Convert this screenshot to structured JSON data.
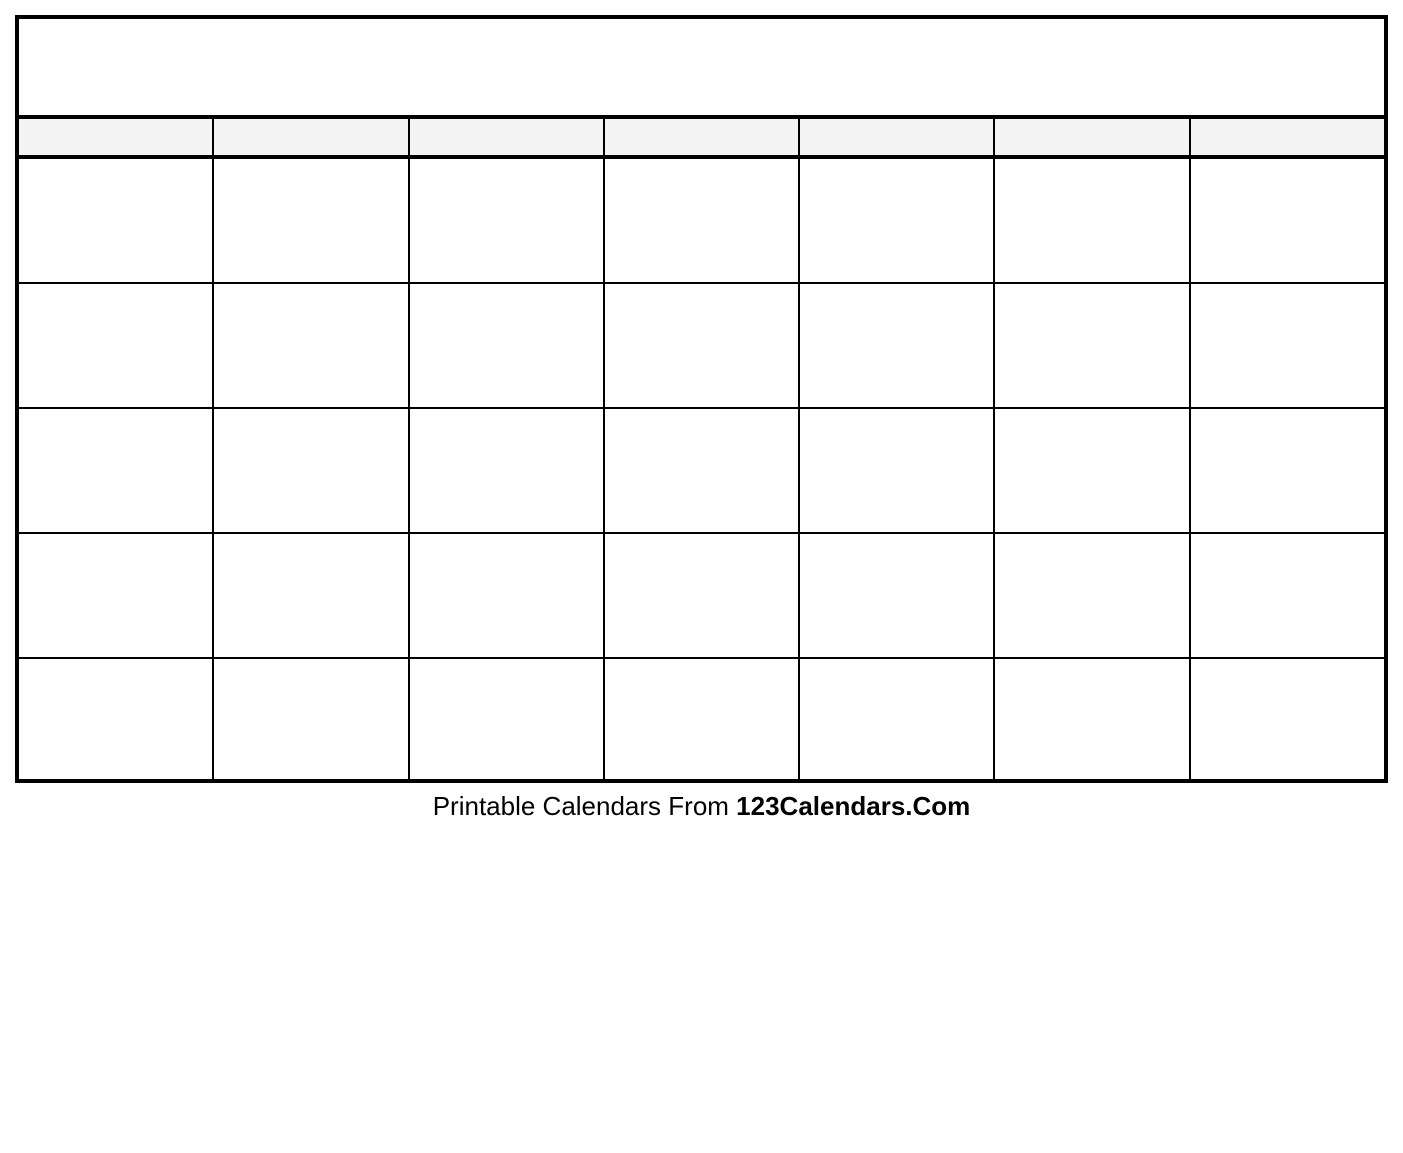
{
  "calendar": {
    "title": "",
    "columns": 7,
    "rows": 5,
    "header_labels": [
      "",
      "",
      "",
      "",
      "",
      "",
      ""
    ]
  },
  "caption": {
    "prefix": "Printable Calendars From ",
    "source": "123Calendars.Com"
  }
}
